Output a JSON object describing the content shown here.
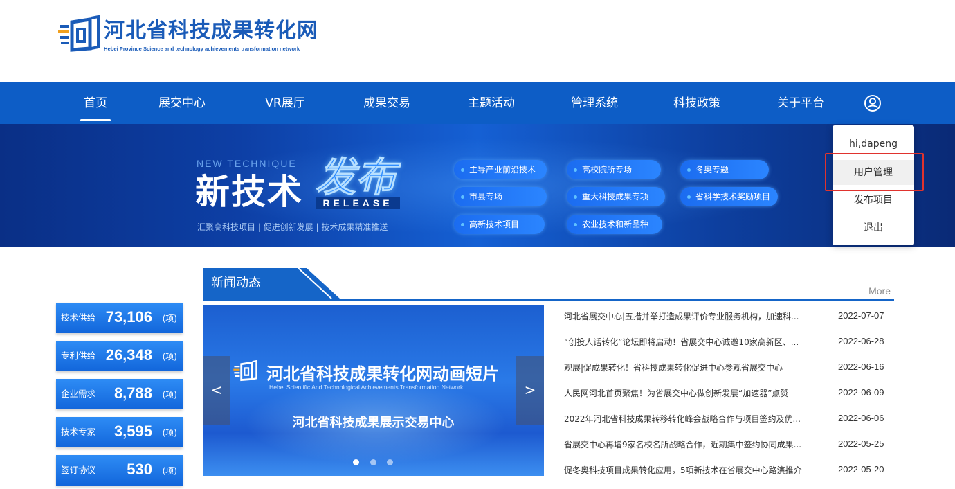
{
  "site": {
    "title": "河北省科技成果转化网",
    "subtitle": "Hebei Province Science and technology achievements transformation network"
  },
  "nav": {
    "items": [
      {
        "label": "首页"
      },
      {
        "label": "展交中心"
      },
      {
        "label": "VR展厅"
      },
      {
        "label": "成果交易"
      },
      {
        "label": "主题活动"
      },
      {
        "label": "管理系统"
      },
      {
        "label": "科技政策"
      },
      {
        "label": "关于平台"
      }
    ],
    "active": "首页",
    "user_icon": "user-circle-icon"
  },
  "banner": {
    "en_text": "NEW TECHNIQUE",
    "title_a": "新技术",
    "title_b": "发布",
    "release": "RELEASE",
    "slogan": "汇聚高科技项目 | 促进创新发展 | 技术成果精准推送",
    "tags": [
      "主导产业前沿技术",
      "高校院所专场",
      "冬奥专题",
      "市县专场",
      "重大科技成果专项",
      "省科学技术奖励项目",
      "高新技术项目",
      "农业技术和新品种"
    ]
  },
  "user_menu": {
    "greeting": "hi,dapeng",
    "items": [
      "用户管理",
      "发布项目",
      "退出"
    ],
    "highlighted": "用户管理"
  },
  "stats": [
    {
      "label": "技术供给",
      "value": "73,106",
      "unit": "(项)"
    },
    {
      "label": "专利供给",
      "value": "26,348",
      "unit": "(项)"
    },
    {
      "label": "企业需求",
      "value": "8,788",
      "unit": "(项)"
    },
    {
      "label": "技术专家",
      "value": "3,595",
      "unit": "(项)"
    },
    {
      "label": "签订协议",
      "value": "530",
      "unit": "(项)"
    }
  ],
  "news": {
    "heading": "新闻动态",
    "more": "More",
    "video": {
      "title": "河北省科技成果转化网动画短片",
      "subtitle_en": "Hebei Scientific And Technological Achievements Transformation Network",
      "caption": "河北省科技成果展示交易中心",
      "prev": "<",
      "next": ">",
      "dots": 3,
      "active_dot": 0
    },
    "items": [
      {
        "title": "河北省展交中心|五措并举打造成果评价专业服务机构，加速科...",
        "date": "2022-07-07"
      },
      {
        "title": "“创投人话转化”论坛即将启动！省展交中心诚邀10家高新区、...",
        "date": "2022-06-28"
      },
      {
        "title": "观展|促成果转化！省科技成果转化促进中心参观省展交中心",
        "date": "2022-06-16"
      },
      {
        "title": "人民网河北首页聚焦！为省展交中心做创新发展“加速器”点赞",
        "date": "2022-06-09"
      },
      {
        "title": "2022年河北省科技成果转移转化峰会战略合作与项目签约及优...",
        "date": "2022-06-06"
      },
      {
        "title": "省展交中心再增9家名校名所战略合作，近期集中签约协同成果...",
        "date": "2022-05-25"
      },
      {
        "title": "促冬奥科技项目成果转化应用，5项新技术在省展交中心路演推介",
        "date": "2022-05-20"
      }
    ]
  },
  "colors": {
    "brand": "#0d5dc6",
    "highlight": "#e0332e"
  }
}
